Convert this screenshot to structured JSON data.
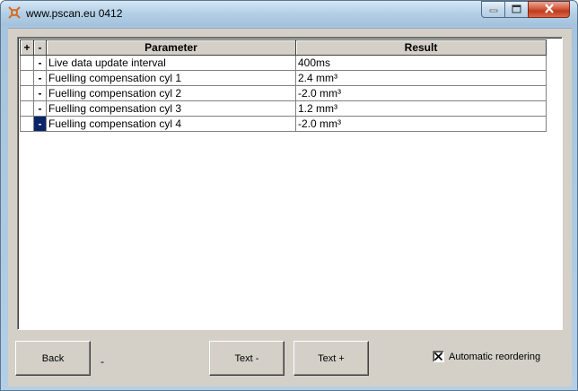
{
  "window": {
    "title": "www.pscan.eu 0412",
    "controls": {
      "minimize": "minimize",
      "maximize": "maximize",
      "close": "close"
    }
  },
  "grid": {
    "headers": {
      "plus": "+",
      "minus": "-",
      "parameter": "Parameter",
      "result": "Result"
    },
    "rows": [
      {
        "marker": "-",
        "parameter": "Live data update interval",
        "result": "400ms"
      },
      {
        "marker": "-",
        "parameter": "Fuelling compensation cyl 1",
        "result": "2.4 mm³"
      },
      {
        "marker": "-",
        "parameter": "Fuelling compensation cyl 2",
        "result": "-2.0 mm³"
      },
      {
        "marker": "-",
        "parameter": "Fuelling compensation cyl 3",
        "result": "1.2 mm³"
      },
      {
        "marker": "-",
        "parameter": "Fuelling compensation cyl 4",
        "result": "-2.0 mm³"
      }
    ],
    "selected_row": 4
  },
  "toolbar": {
    "back_label": "Back",
    "status_text": "-",
    "text_minus_label": "Text -",
    "text_plus_label": "Text +",
    "auto_reorder_label": "Automatic reordering",
    "auto_reorder_checked": true
  },
  "colors": {
    "selection": "#0a246a",
    "face": "#d4d0c8",
    "close_button": "#c23a1c"
  }
}
